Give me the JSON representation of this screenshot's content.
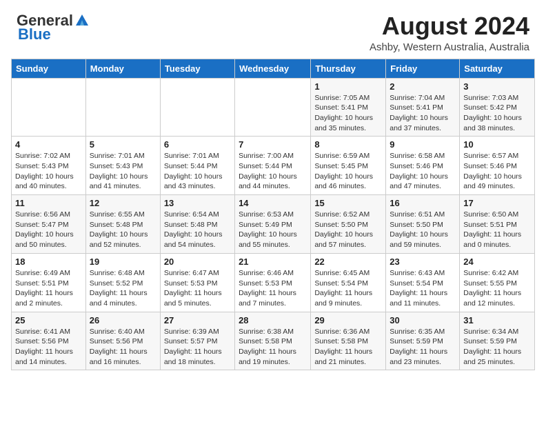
{
  "header": {
    "logo_general": "General",
    "logo_blue": "Blue",
    "main_title": "August 2024",
    "subtitle": "Ashby, Western Australia, Australia"
  },
  "calendar": {
    "days_of_week": [
      "Sunday",
      "Monday",
      "Tuesday",
      "Wednesday",
      "Thursday",
      "Friday",
      "Saturday"
    ],
    "weeks": [
      [
        {
          "day": "",
          "info": ""
        },
        {
          "day": "",
          "info": ""
        },
        {
          "day": "",
          "info": ""
        },
        {
          "day": "",
          "info": ""
        },
        {
          "day": "1",
          "info": "Sunrise: 7:05 AM\nSunset: 5:41 PM\nDaylight: 10 hours\nand 35 minutes."
        },
        {
          "day": "2",
          "info": "Sunrise: 7:04 AM\nSunset: 5:41 PM\nDaylight: 10 hours\nand 37 minutes."
        },
        {
          "day": "3",
          "info": "Sunrise: 7:03 AM\nSunset: 5:42 PM\nDaylight: 10 hours\nand 38 minutes."
        }
      ],
      [
        {
          "day": "4",
          "info": "Sunrise: 7:02 AM\nSunset: 5:43 PM\nDaylight: 10 hours\nand 40 minutes."
        },
        {
          "day": "5",
          "info": "Sunrise: 7:01 AM\nSunset: 5:43 PM\nDaylight: 10 hours\nand 41 minutes."
        },
        {
          "day": "6",
          "info": "Sunrise: 7:01 AM\nSunset: 5:44 PM\nDaylight: 10 hours\nand 43 minutes."
        },
        {
          "day": "7",
          "info": "Sunrise: 7:00 AM\nSunset: 5:44 PM\nDaylight: 10 hours\nand 44 minutes."
        },
        {
          "day": "8",
          "info": "Sunrise: 6:59 AM\nSunset: 5:45 PM\nDaylight: 10 hours\nand 46 minutes."
        },
        {
          "day": "9",
          "info": "Sunrise: 6:58 AM\nSunset: 5:46 PM\nDaylight: 10 hours\nand 47 minutes."
        },
        {
          "day": "10",
          "info": "Sunrise: 6:57 AM\nSunset: 5:46 PM\nDaylight: 10 hours\nand 49 minutes."
        }
      ],
      [
        {
          "day": "11",
          "info": "Sunrise: 6:56 AM\nSunset: 5:47 PM\nDaylight: 10 hours\nand 50 minutes."
        },
        {
          "day": "12",
          "info": "Sunrise: 6:55 AM\nSunset: 5:48 PM\nDaylight: 10 hours\nand 52 minutes."
        },
        {
          "day": "13",
          "info": "Sunrise: 6:54 AM\nSunset: 5:48 PM\nDaylight: 10 hours\nand 54 minutes."
        },
        {
          "day": "14",
          "info": "Sunrise: 6:53 AM\nSunset: 5:49 PM\nDaylight: 10 hours\nand 55 minutes."
        },
        {
          "day": "15",
          "info": "Sunrise: 6:52 AM\nSunset: 5:50 PM\nDaylight: 10 hours\nand 57 minutes."
        },
        {
          "day": "16",
          "info": "Sunrise: 6:51 AM\nSunset: 5:50 PM\nDaylight: 10 hours\nand 59 minutes."
        },
        {
          "day": "17",
          "info": "Sunrise: 6:50 AM\nSunset: 5:51 PM\nDaylight: 11 hours\nand 0 minutes."
        }
      ],
      [
        {
          "day": "18",
          "info": "Sunrise: 6:49 AM\nSunset: 5:51 PM\nDaylight: 11 hours\nand 2 minutes."
        },
        {
          "day": "19",
          "info": "Sunrise: 6:48 AM\nSunset: 5:52 PM\nDaylight: 11 hours\nand 4 minutes."
        },
        {
          "day": "20",
          "info": "Sunrise: 6:47 AM\nSunset: 5:53 PM\nDaylight: 11 hours\nand 5 minutes."
        },
        {
          "day": "21",
          "info": "Sunrise: 6:46 AM\nSunset: 5:53 PM\nDaylight: 11 hours\nand 7 minutes."
        },
        {
          "day": "22",
          "info": "Sunrise: 6:45 AM\nSunset: 5:54 PM\nDaylight: 11 hours\nand 9 minutes."
        },
        {
          "day": "23",
          "info": "Sunrise: 6:43 AM\nSunset: 5:54 PM\nDaylight: 11 hours\nand 11 minutes."
        },
        {
          "day": "24",
          "info": "Sunrise: 6:42 AM\nSunset: 5:55 PM\nDaylight: 11 hours\nand 12 minutes."
        }
      ],
      [
        {
          "day": "25",
          "info": "Sunrise: 6:41 AM\nSunset: 5:56 PM\nDaylight: 11 hours\nand 14 minutes."
        },
        {
          "day": "26",
          "info": "Sunrise: 6:40 AM\nSunset: 5:56 PM\nDaylight: 11 hours\nand 16 minutes."
        },
        {
          "day": "27",
          "info": "Sunrise: 6:39 AM\nSunset: 5:57 PM\nDaylight: 11 hours\nand 18 minutes."
        },
        {
          "day": "28",
          "info": "Sunrise: 6:38 AM\nSunset: 5:58 PM\nDaylight: 11 hours\nand 19 minutes."
        },
        {
          "day": "29",
          "info": "Sunrise: 6:36 AM\nSunset: 5:58 PM\nDaylight: 11 hours\nand 21 minutes."
        },
        {
          "day": "30",
          "info": "Sunrise: 6:35 AM\nSunset: 5:59 PM\nDaylight: 11 hours\nand 23 minutes."
        },
        {
          "day": "31",
          "info": "Sunrise: 6:34 AM\nSunset: 5:59 PM\nDaylight: 11 hours\nand 25 minutes."
        }
      ]
    ]
  }
}
